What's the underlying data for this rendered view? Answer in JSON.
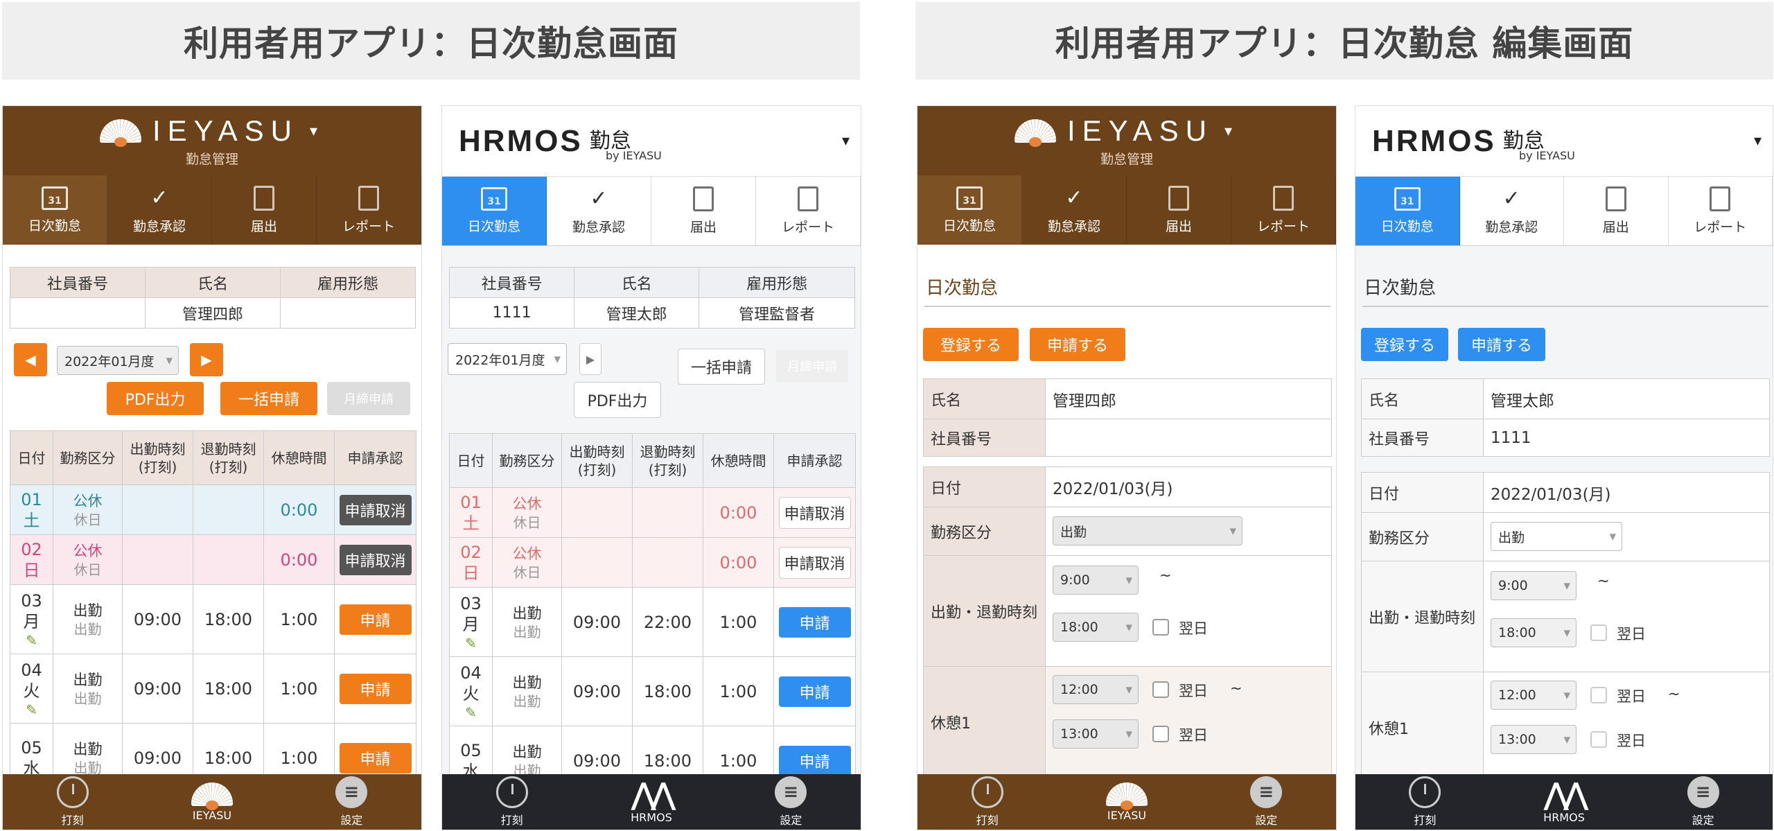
{
  "banners": {
    "left": "利用者用アプリ：日次勤怠画面",
    "right": "利用者用アプリ：日次勤怠 編集画面"
  },
  "ieyasu": {
    "logo": "IEYASU",
    "subtitle": "勤怠管理",
    "caret": "▾"
  },
  "hrmos": {
    "wordmark": "HRMOS",
    "kintai": "勤怠",
    "by": "by IEYASU",
    "caret": "▾"
  },
  "tabs": {
    "daily": "日次勤怠",
    "approval": "勤怠承認",
    "submit": "届出",
    "report": "レポート",
    "cal_day": "31"
  },
  "bottom": {
    "punch": "打刻",
    "ieyasu": "IEYASU",
    "hrmos": "HRMOS",
    "settings": "設定"
  },
  "info_headers": [
    "社員番号",
    "氏名",
    "雇用形態"
  ],
  "screen1": {
    "emp_no": "",
    "name": "管理四郎",
    "emp_type": "",
    "period": "2022年01月度",
    "pdf": "PDF出力",
    "bulk": "一括申請",
    "monthly": "月締申請"
  },
  "screen2": {
    "emp_no": "1111",
    "name": "管理太郎",
    "emp_type": "管理監督者",
    "period": "2022年01月度",
    "pdf": "PDF出力",
    "bulk": "一括申請",
    "monthly": "月締申請"
  },
  "att_headers": {
    "date": "日付",
    "kubun": "勤務区分",
    "in1": "出勤時刻",
    "in2": "(打刻)",
    "out1": "退勤時刻",
    "out2": "(打刻)",
    "rest": "休憩時間",
    "apply": "申請承認"
  },
  "rows1": [
    {
      "day": "01",
      "dow": "土",
      "k1": "公休",
      "k2": "休日",
      "in": "",
      "out": "",
      "rest": "0:00",
      "btn": "申請取消"
    },
    {
      "day": "02",
      "dow": "日",
      "k1": "公休",
      "k2": "休日",
      "in": "",
      "out": "",
      "rest": "0:00",
      "btn": "申請取消"
    },
    {
      "day": "03",
      "dow": "月",
      "k1": "出勤",
      "k2": "出勤",
      "in": "09:00",
      "out": "18:00",
      "rest": "1:00",
      "btn": "申請"
    },
    {
      "day": "04",
      "dow": "火",
      "k1": "出勤",
      "k2": "出勤",
      "in": "09:00",
      "out": "18:00",
      "rest": "1:00",
      "btn": "申請"
    },
    {
      "day": "05",
      "dow": "水",
      "k1": "出勤",
      "k2": "出勤",
      "in": "09:00",
      "out": "18:00",
      "rest": "1:00",
      "btn": "申請"
    }
  ],
  "rows2": [
    {
      "day": "01",
      "dow": "土",
      "k1": "公休",
      "k2": "休日",
      "in": "",
      "out": "",
      "rest": "0:00",
      "btn": "申請取消"
    },
    {
      "day": "02",
      "dow": "日",
      "k1": "公休",
      "k2": "休日",
      "in": "",
      "out": "",
      "rest": "0:00",
      "btn": "申請取消"
    },
    {
      "day": "03",
      "dow": "月",
      "k1": "出勤",
      "k2": "出勤",
      "in": "09:00",
      "out": "22:00",
      "rest": "1:00",
      "btn": "申請"
    },
    {
      "day": "04",
      "dow": "火",
      "k1": "出勤",
      "k2": "出勤",
      "in": "09:00",
      "out": "18:00",
      "rest": "1:00",
      "btn": "申請"
    },
    {
      "day": "05",
      "dow": "水",
      "k1": "出勤",
      "k2": "出勤",
      "in": "09:00",
      "out": "18:00",
      "rest": "1:00",
      "btn": "申請"
    }
  ],
  "edit": {
    "title": "日次勤怠",
    "save": "登録する",
    "apply": "申請する",
    "name_label": "氏名",
    "emp_label": "社員番号",
    "date_label": "日付",
    "kubun_label": "勤務区分",
    "inout_label": "出勤・退勤時刻",
    "rest_label": "休憩1",
    "date": "2022/01/03(月)",
    "kubun": "出勤",
    "in": "9:00",
    "out": "18:00",
    "rest_start": "12:00",
    "rest_end": "13:00",
    "next_day": "翌日",
    "tilde": "~"
  },
  "edit3": {
    "name": "管理四郎",
    "emp_no": ""
  },
  "edit4": {
    "name": "管理太郎",
    "emp_no": "1111"
  }
}
